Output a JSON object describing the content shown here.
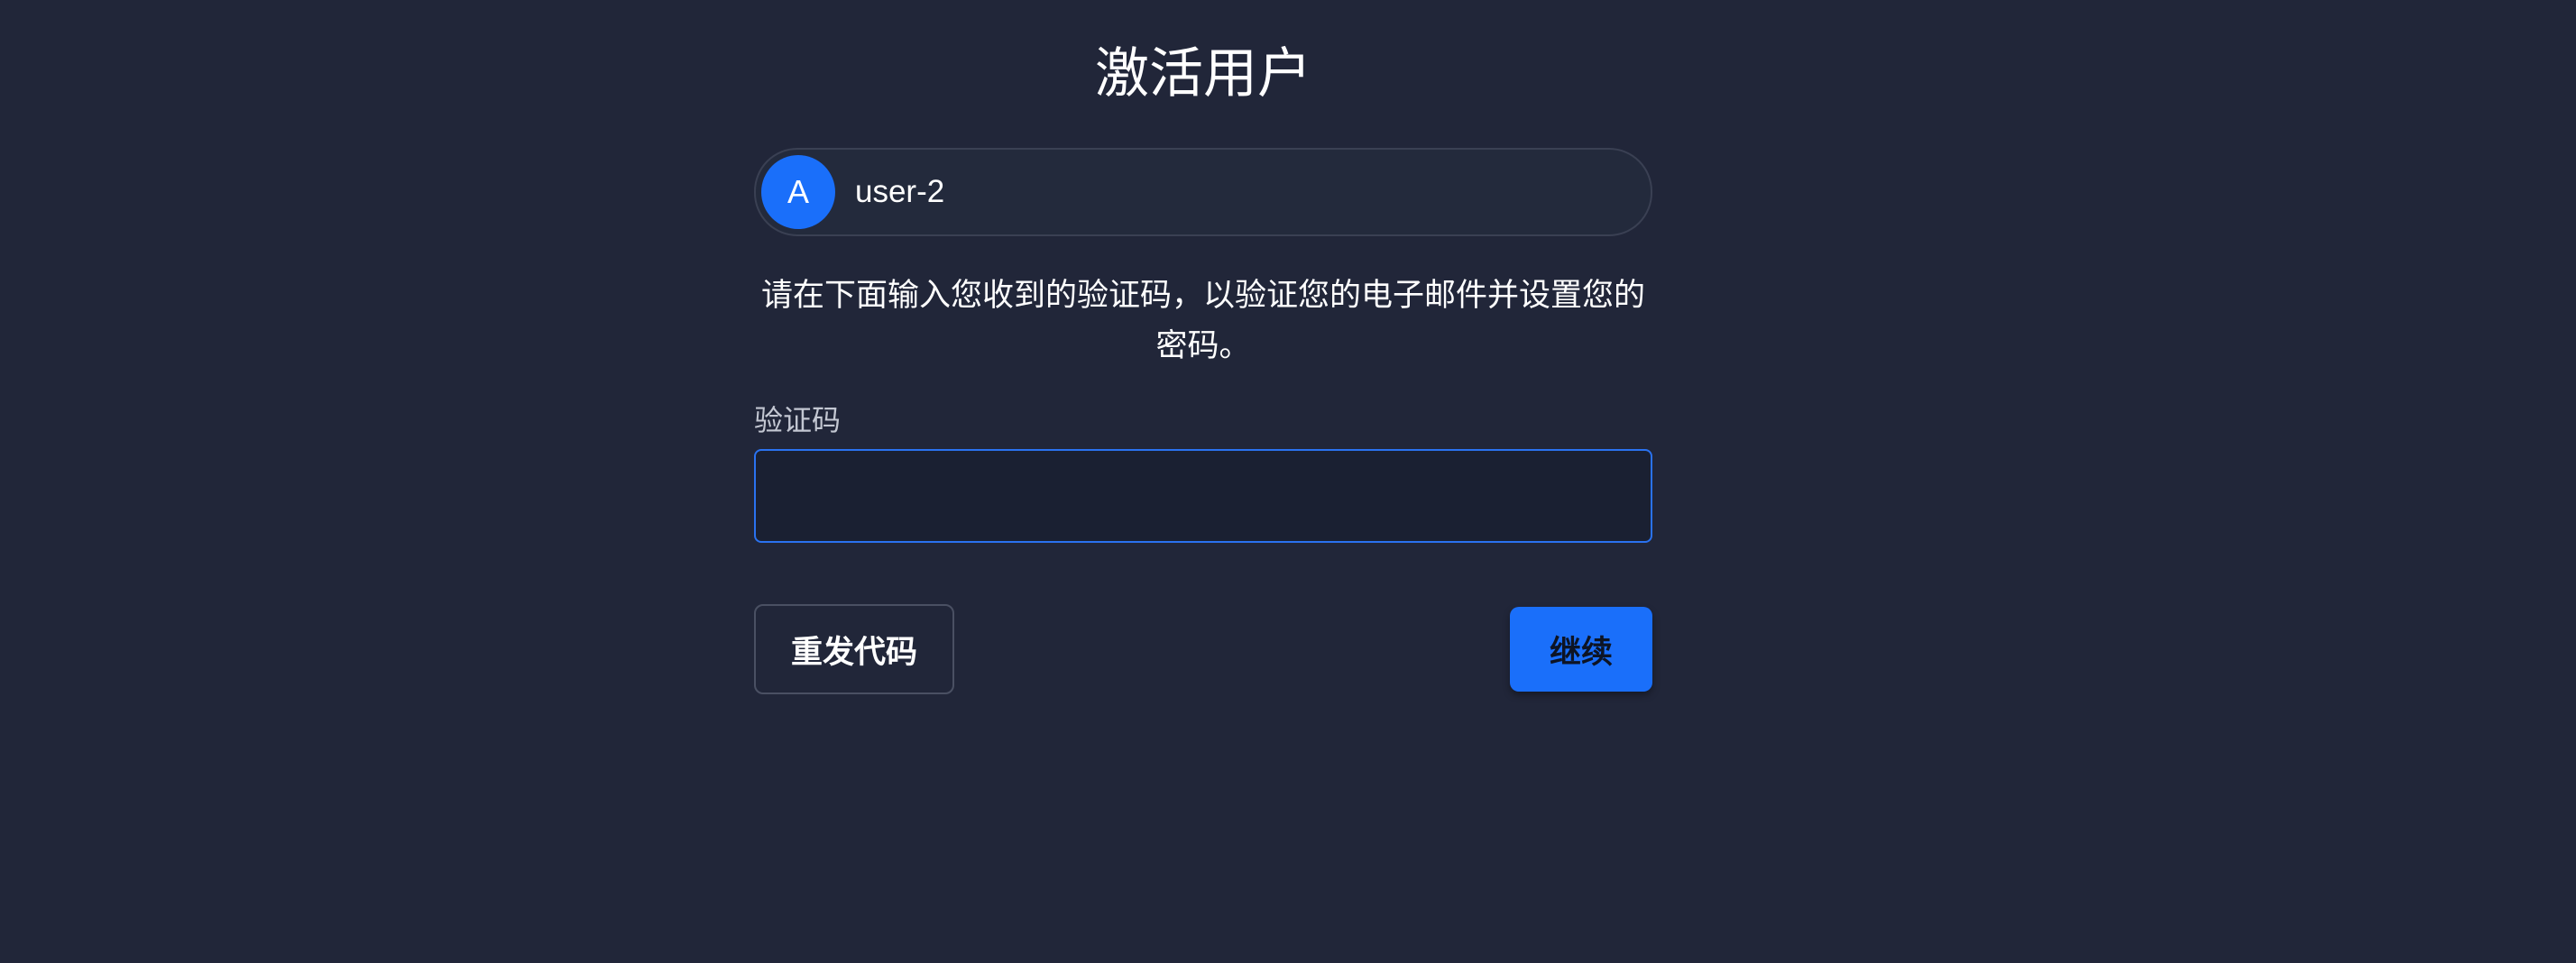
{
  "page": {
    "title": "激活用户"
  },
  "user": {
    "avatar_initial": "A",
    "username": "user-2"
  },
  "instructions": {
    "text": "请在下面输入您收到的验证码，以验证您的电子邮件并设置您的密码。"
  },
  "form": {
    "code_label": "验证码",
    "code_value": "",
    "code_placeholder": ""
  },
  "actions": {
    "resend_label": "重发代码",
    "continue_label": "继续"
  },
  "colors": {
    "background": "#212639",
    "accent": "#1a6ffa",
    "input_border": "#2a72f0"
  }
}
